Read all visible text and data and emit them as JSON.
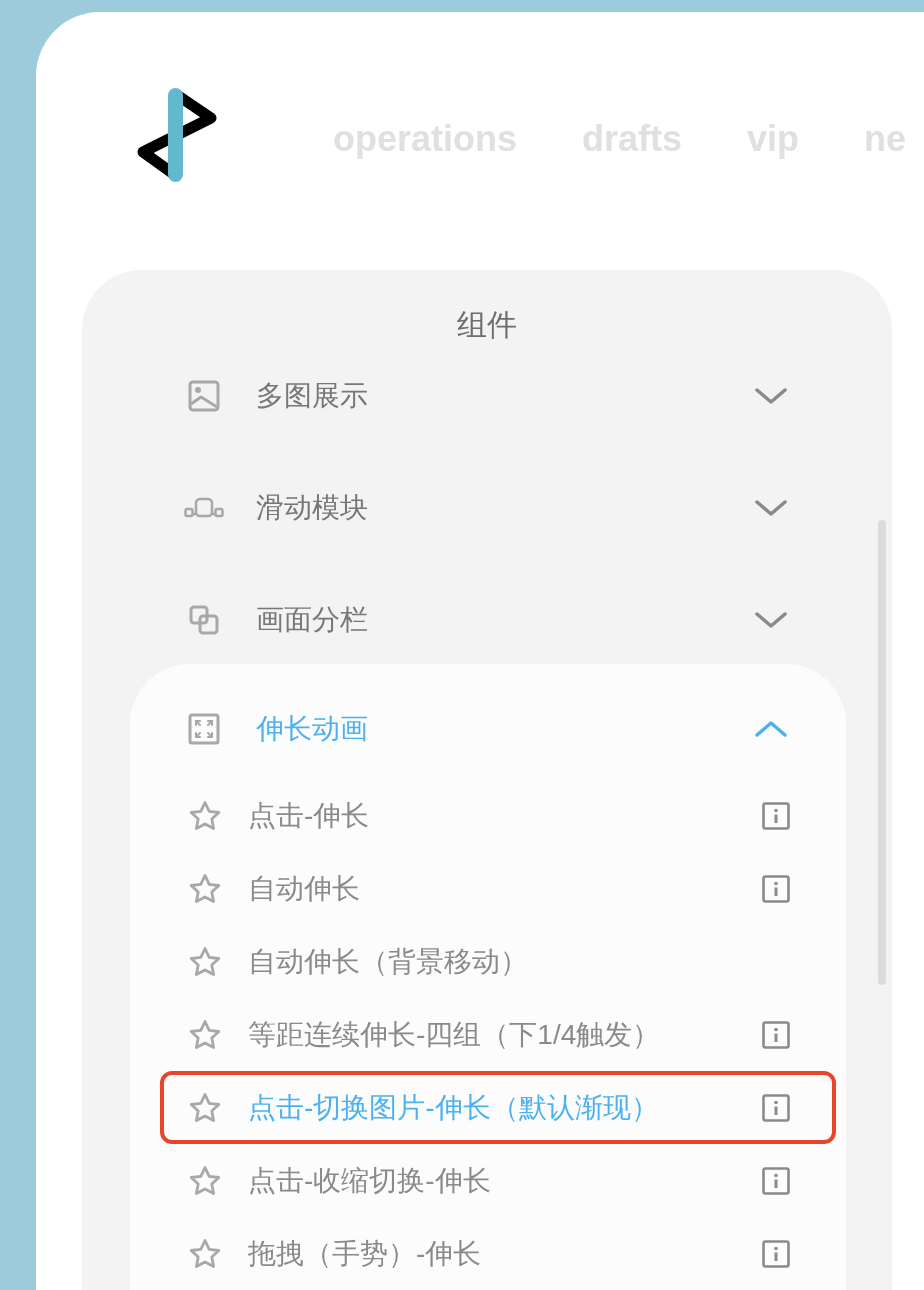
{
  "nav": {
    "links": [
      "operations",
      "drafts",
      "vip",
      "ne"
    ]
  },
  "panel": {
    "title": "组件",
    "groups": [
      {
        "label": "多图展示",
        "expanded": false
      },
      {
        "label": "滑动模块",
        "expanded": false
      },
      {
        "label": "画面分栏",
        "expanded": false
      },
      {
        "label": "伸长动画",
        "expanded": true,
        "items": [
          {
            "label": "点击-伸长",
            "info": true,
            "selected": false
          },
          {
            "label": "自动伸长",
            "info": true,
            "selected": false
          },
          {
            "label": "自动伸长（背景移动）",
            "info": false,
            "selected": false
          },
          {
            "label": "等距连续伸长-四组（下1/4触发）",
            "info": true,
            "selected": false
          },
          {
            "label": "点击-切换图片-伸长（默认渐现）",
            "info": true,
            "selected": true
          },
          {
            "label": "点击-收缩切换-伸长",
            "info": true,
            "selected": false
          },
          {
            "label": "拖拽（手势）-伸长",
            "info": true,
            "selected": false
          }
        ]
      }
    ]
  }
}
